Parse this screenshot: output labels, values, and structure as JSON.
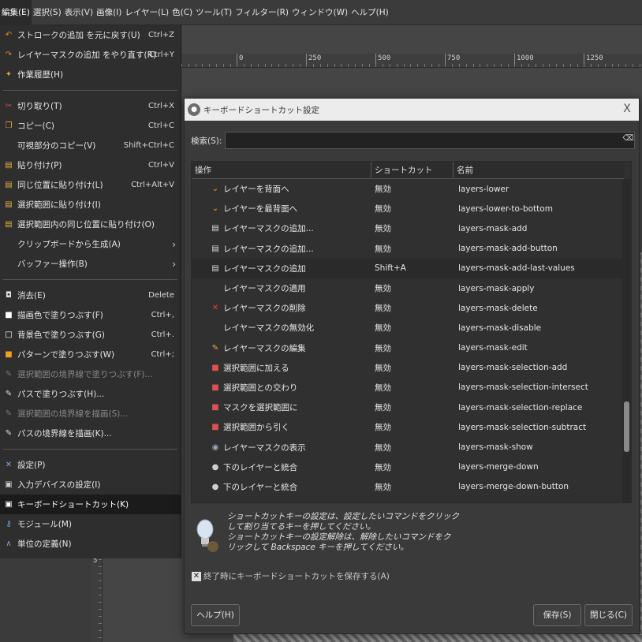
{
  "menubar": {
    "items": [
      {
        "label": "編集(E)"
      },
      {
        "label": "選択(S)"
      },
      {
        "label": "表示(V)"
      },
      {
        "label": "画像(I)"
      },
      {
        "label": "レイヤー(L)"
      },
      {
        "label": "色(C)"
      },
      {
        "label": "ツール(T)"
      },
      {
        "label": "フィルター(R)"
      },
      {
        "label": "ウィンドウ(W)"
      },
      {
        "label": "ヘルプ(H)"
      }
    ]
  },
  "ruler": {
    "top_labels": [
      "0",
      "250",
      "500",
      "750",
      "1000",
      "1250"
    ],
    "left_label": "5"
  },
  "edit_menu": {
    "items": [
      {
        "icon": "undo-icon",
        "glyph": "↶",
        "color": "#e08a2a",
        "label": "ストロークの追加 を元に戻す(U)",
        "shortcut": "Ctrl+Z"
      },
      {
        "icon": "redo-icon",
        "glyph": "↷",
        "color": "#e08a2a",
        "label": "レイヤーマスクの追加 をやり直す(R)",
        "shortcut": "Ctrl+Y"
      },
      {
        "icon": "history-icon",
        "glyph": "✦",
        "color": "#e0a030",
        "label": "作業履歴(H)",
        "shortcut": ""
      },
      {
        "sep": true
      },
      {
        "icon": "cut-icon",
        "glyph": "✂",
        "color": "#d94a4a",
        "label": "切り取り(T)",
        "shortcut": "Ctrl+X"
      },
      {
        "icon": "copy-icon",
        "glyph": "❐",
        "color": "#e0b040",
        "label": "コピー(C)",
        "shortcut": "Ctrl+C"
      },
      {
        "icon": "",
        "glyph": "",
        "color": "",
        "label": "可視部分のコピー(V)",
        "shortcut": "Shift+Ctrl+C"
      },
      {
        "icon": "paste-icon",
        "glyph": "▤",
        "color": "#e0b040",
        "label": "貼り付け(P)",
        "shortcut": "Ctrl+V"
      },
      {
        "icon": "paste-in-place-icon",
        "glyph": "▤",
        "color": "#e0b040",
        "label": "同じ位置に貼り付け(L)",
        "shortcut": "Ctrl+Alt+V"
      },
      {
        "icon": "paste-into-icon",
        "glyph": "▤",
        "color": "#e0b040",
        "label": "選択範囲に貼り付け(I)",
        "shortcut": ""
      },
      {
        "icon": "paste-into-in-place-icon",
        "glyph": "▤",
        "color": "#e0b040",
        "label": "選択範囲内の同じ位置に貼り付け(O)",
        "shortcut": ""
      },
      {
        "icon": "",
        "glyph": "",
        "color": "",
        "label": "クリップボードから生成(A)",
        "shortcut": "",
        "submenu": true
      },
      {
        "icon": "",
        "glyph": "",
        "color": "",
        "label": "バッファー操作(B)",
        "shortcut": "",
        "submenu": true
      },
      {
        "sep": true
      },
      {
        "icon": "clear-icon",
        "glyph": "◘",
        "color": "#dddddd",
        "label": "消去(E)",
        "shortcut": "Delete"
      },
      {
        "icon": "fg-fill-icon",
        "glyph": "■",
        "color": "#ffffff",
        "label": "描画色で塗りつぶす(F)",
        "shortcut": "Ctrl+,"
      },
      {
        "icon": "bg-fill-icon",
        "glyph": "□",
        "color": "#ffffff",
        "label": "背景色で塗りつぶす(G)",
        "shortcut": "Ctrl+."
      },
      {
        "icon": "pattern-fill-icon",
        "glyph": "■",
        "color": "#f0a020",
        "label": "パターンで塗りつぶす(W)",
        "shortcut": "Ctrl+;"
      },
      {
        "icon": "fill-selection-outline-icon",
        "glyph": "✎",
        "color": "#777777",
        "label": "選択範囲の境界線で塗りつぶす(F)...",
        "shortcut": "",
        "disabled": true
      },
      {
        "icon": "fill-path-icon",
        "glyph": "✎",
        "color": "#dddddd",
        "label": "パスで塗りつぶす(H)...",
        "shortcut": ""
      },
      {
        "icon": "stroke-selection-icon",
        "glyph": "✎",
        "color": "#777777",
        "label": "選択範囲の境界線を描画(S)...",
        "shortcut": "",
        "disabled": true
      },
      {
        "icon": "stroke-path-icon",
        "glyph": "✎",
        "color": "#dddddd",
        "label": "パスの境界線を描画(K)...",
        "shortcut": ""
      },
      {
        "sep": true
      },
      {
        "icon": "preferences-icon",
        "glyph": "✕",
        "color": "#7fa7d9",
        "label": "設定(P)",
        "shortcut": ""
      },
      {
        "icon": "input-devices-icon",
        "glyph": "▣",
        "color": "#cfcfcf",
        "label": "入力デバイスの設定(I)",
        "shortcut": ""
      },
      {
        "icon": "keyboard-shortcuts-icon",
        "glyph": "▣",
        "color": "#ffffff",
        "label": "キーボードショートカット(K)",
        "shortcut": "",
        "selected": true
      },
      {
        "icon": "modules-icon",
        "glyph": "⚷",
        "color": "#7fa7d9",
        "label": "モジュール(M)",
        "shortcut": ""
      },
      {
        "icon": "units-icon",
        "glyph": "∧",
        "color": "#7fa7d9",
        "label": "単位の定義(N)",
        "shortcut": ""
      }
    ]
  },
  "dialog": {
    "title": "キーボードショートカット設定",
    "close_glyph": "X",
    "search_label": "検索(S):",
    "search_value": "",
    "columns": [
      "操作",
      "ショートカット",
      "名前"
    ],
    "rows": [
      {
        "icon": "layer-lower-icon",
        "glyph": "⌄",
        "color": "#f0a020",
        "action": "レイヤーを背面へ",
        "shortcut": "無効",
        "name": "layers-lower"
      },
      {
        "icon": "layer-bottom-icon",
        "glyph": "⌄",
        "color": "#f0a020",
        "action": "レイヤーを最背面へ",
        "shortcut": "無効",
        "name": "layers-lower-to-bottom"
      },
      {
        "icon": "mask-add-icon",
        "glyph": "▤",
        "color": "#dcdcdc",
        "action": "レイヤーマスクの追加...",
        "shortcut": "無効",
        "name": "layers-mask-add"
      },
      {
        "icon": "mask-add-icon",
        "glyph": "▤",
        "color": "#dcdcdc",
        "action": "レイヤーマスクの追加...",
        "shortcut": "無効",
        "name": "layers-mask-add-button"
      },
      {
        "icon": "mask-add-icon",
        "glyph": "▤",
        "color": "#dcdcdc",
        "action": "レイヤーマスクの追加",
        "shortcut": "Shift+A",
        "name": "layers-mask-add-last-values",
        "selected": true
      },
      {
        "icon": "",
        "glyph": "",
        "color": "",
        "action": "レイヤーマスクの適用",
        "shortcut": "無効",
        "name": "layers-mask-apply"
      },
      {
        "icon": "mask-delete-icon",
        "glyph": "✕",
        "color": "#e04040",
        "action": "レイヤーマスクの削除",
        "shortcut": "無効",
        "name": "layers-mask-delete"
      },
      {
        "icon": "",
        "glyph": "",
        "color": "",
        "action": "レイヤーマスクの無効化",
        "shortcut": "無効",
        "name": "layers-mask-disable"
      },
      {
        "icon": "mask-edit-icon",
        "glyph": "✎",
        "color": "#e0b040",
        "action": "レイヤーマスクの編集",
        "shortcut": "無効",
        "name": "layers-mask-edit"
      },
      {
        "icon": "selection-add-icon",
        "glyph": "■",
        "color": "#e05050",
        "action": "選択範囲に加える",
        "shortcut": "無効",
        "name": "layers-mask-selection-add"
      },
      {
        "icon": "selection-intersect-icon",
        "glyph": "■",
        "color": "#e05050",
        "action": "選択範囲との交わり",
        "shortcut": "無効",
        "name": "layers-mask-selection-intersect"
      },
      {
        "icon": "selection-replace-icon",
        "glyph": "■",
        "color": "#e05050",
        "action": "マスクを選択範囲に",
        "shortcut": "無効",
        "name": "layers-mask-selection-replace"
      },
      {
        "icon": "selection-subtract-icon",
        "glyph": "■",
        "color": "#e05050",
        "action": "選択範囲から引く",
        "shortcut": "無効",
        "name": "layers-mask-selection-subtract"
      },
      {
        "icon": "mask-show-icon",
        "glyph": "◉",
        "color": "#9ab",
        "action": "レイヤーマスクの表示",
        "shortcut": "無効",
        "name": "layers-mask-show"
      },
      {
        "icon": "merge-down-icon",
        "glyph": "●",
        "color": "#cfcfcf",
        "action": "下のレイヤーと統合",
        "shortcut": "無効",
        "name": "layers-merge-down"
      },
      {
        "icon": "merge-down-icon",
        "glyph": "●",
        "color": "#cfcfcf",
        "action": "下のレイヤーと統合",
        "shortcut": "無効",
        "name": "layers-merge-down-button"
      }
    ],
    "info_lines": [
      "ショートカットキーの設定は、設定したいコマンドをクリック",
      "して割り当てるキーを押してください。",
      "ショートカットキーの設定解除は、解除したいコマンドをク",
      "リックして Backspace キーを押してください。"
    ],
    "save_on_exit_label": "終了時にキーボードショートカットを保存する(A)",
    "save_on_exit_checked": true,
    "help_button": "ヘルプ(H)",
    "save_button": "保存(S)",
    "close_button": "閉じる(C)"
  }
}
